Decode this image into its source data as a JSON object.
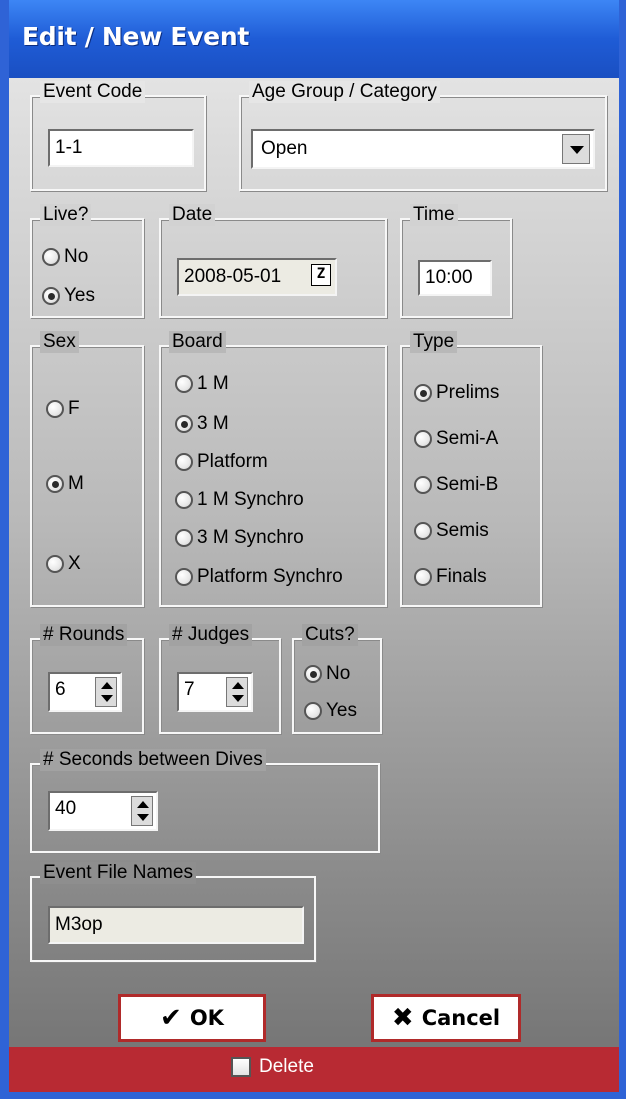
{
  "window": {
    "title": "Edit / New Event"
  },
  "event_code": {
    "label": "Event Code",
    "value": "1-1"
  },
  "age_group": {
    "label": "Age Group / Category",
    "selected": "Open"
  },
  "live": {
    "label": "Live?",
    "options": [
      "No",
      "Yes"
    ],
    "selected": "Yes"
  },
  "date": {
    "label": "Date",
    "value": "2008-05-01",
    "calendar_icon_text": "Z"
  },
  "time": {
    "label": "Time",
    "value": "10:00"
  },
  "sex": {
    "label": "Sex",
    "options": [
      "F",
      "M",
      "X"
    ],
    "selected": "M"
  },
  "board": {
    "label": "Board",
    "options": [
      "1 M",
      "3 M",
      "Platform",
      "1 M Synchro",
      "3 M Synchro",
      "Platform Synchro"
    ],
    "selected": "3 M"
  },
  "type": {
    "label": "Type",
    "options": [
      "Prelims",
      "Semi-A",
      "Semi-B",
      "Semis",
      "Finals"
    ],
    "selected": "Prelims"
  },
  "rounds": {
    "label": "# Rounds",
    "value": "6"
  },
  "judges": {
    "label": "# Judges",
    "value": "7"
  },
  "cuts": {
    "label": "Cuts?",
    "options": [
      "No",
      "Yes"
    ],
    "selected": "No"
  },
  "seconds": {
    "label": "# Seconds between Dives",
    "value": "40"
  },
  "file_names": {
    "label": "Event File Names",
    "value": "M3op"
  },
  "buttons": {
    "ok": "OK",
    "cancel": "Cancel"
  },
  "delete": {
    "label": "Delete",
    "checked": false
  },
  "colors": {
    "title_bar": "#1f5cd6",
    "accent_red": "#b82a33"
  }
}
